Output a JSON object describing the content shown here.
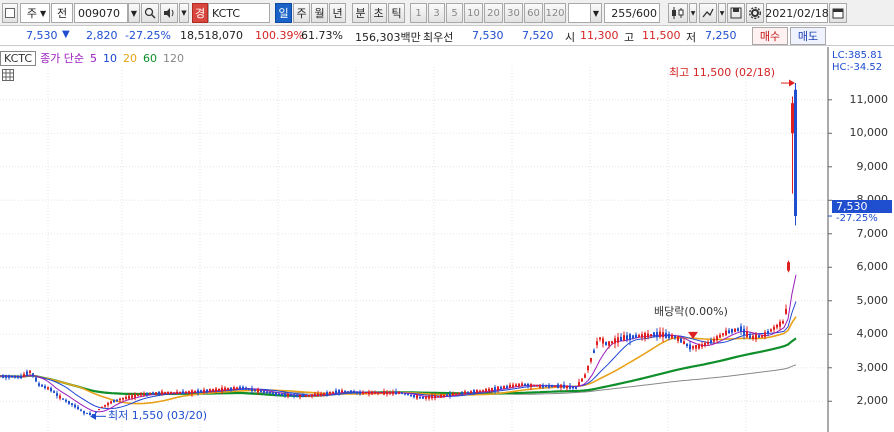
{
  "toolbar": {
    "period_select": "주",
    "prefix_select": "전",
    "stock_code": "009070",
    "market_badge": "경",
    "stock_name": "KCTC",
    "tabs": [
      "일",
      "주",
      "월",
      "년",
      "분",
      "초",
      "틱"
    ],
    "active_tab": "일",
    "intervals": [
      "1",
      "3",
      "5",
      "10",
      "20",
      "30",
      "60",
      "120"
    ],
    "count": "255",
    "count_max": "/600",
    "date": "2021/02/18"
  },
  "quote": {
    "price": "7,530",
    "direction": "▼",
    "change": "2,820",
    "change_pct": "-27.25%",
    "volume": "18,518,070",
    "volume_ratio": "100.39%",
    "turnover": "61.73%",
    "amount": "156,303백만",
    "best_ask_label": "최우선",
    "best_ask": "7,530",
    "best_bid": "7,520",
    "open_label": "시",
    "open": "11,300",
    "high_label": "고",
    "high": "11,500",
    "low_label": "저",
    "low": "7,250",
    "buy_label": "매수",
    "sell_label": "매도"
  },
  "chart": {
    "code_box": "KCTC",
    "legend_title": "종가 단순",
    "ma_labels": [
      "5",
      "10",
      "20",
      "60",
      "120"
    ],
    "ma_colors": [
      "#9b1bbd",
      "#1e47d6",
      "#e8a21a",
      "#0f8f2a",
      "#888888"
    ],
    "lc_label": "LC:385.81",
    "hc_label": "HC:-34.52",
    "current_price_tag": "7,530",
    "current_pct_tag": "-27.25%",
    "high_annotation": "최고 11,500 (02/18)",
    "low_annotation": "최저 1,550 (03/20)",
    "dividend_annotation": "배당락(0.00%)",
    "yaxis_ticks": [
      "11,000",
      "10,000",
      "9,000",
      "8,000",
      "7,000",
      "6,000",
      "5,000",
      "4,000",
      "3,000",
      "2,000"
    ],
    "up_color": "#e02020",
    "down_color": "#1f4ecf",
    "ylim": [
      1500,
      11800
    ]
  }
}
